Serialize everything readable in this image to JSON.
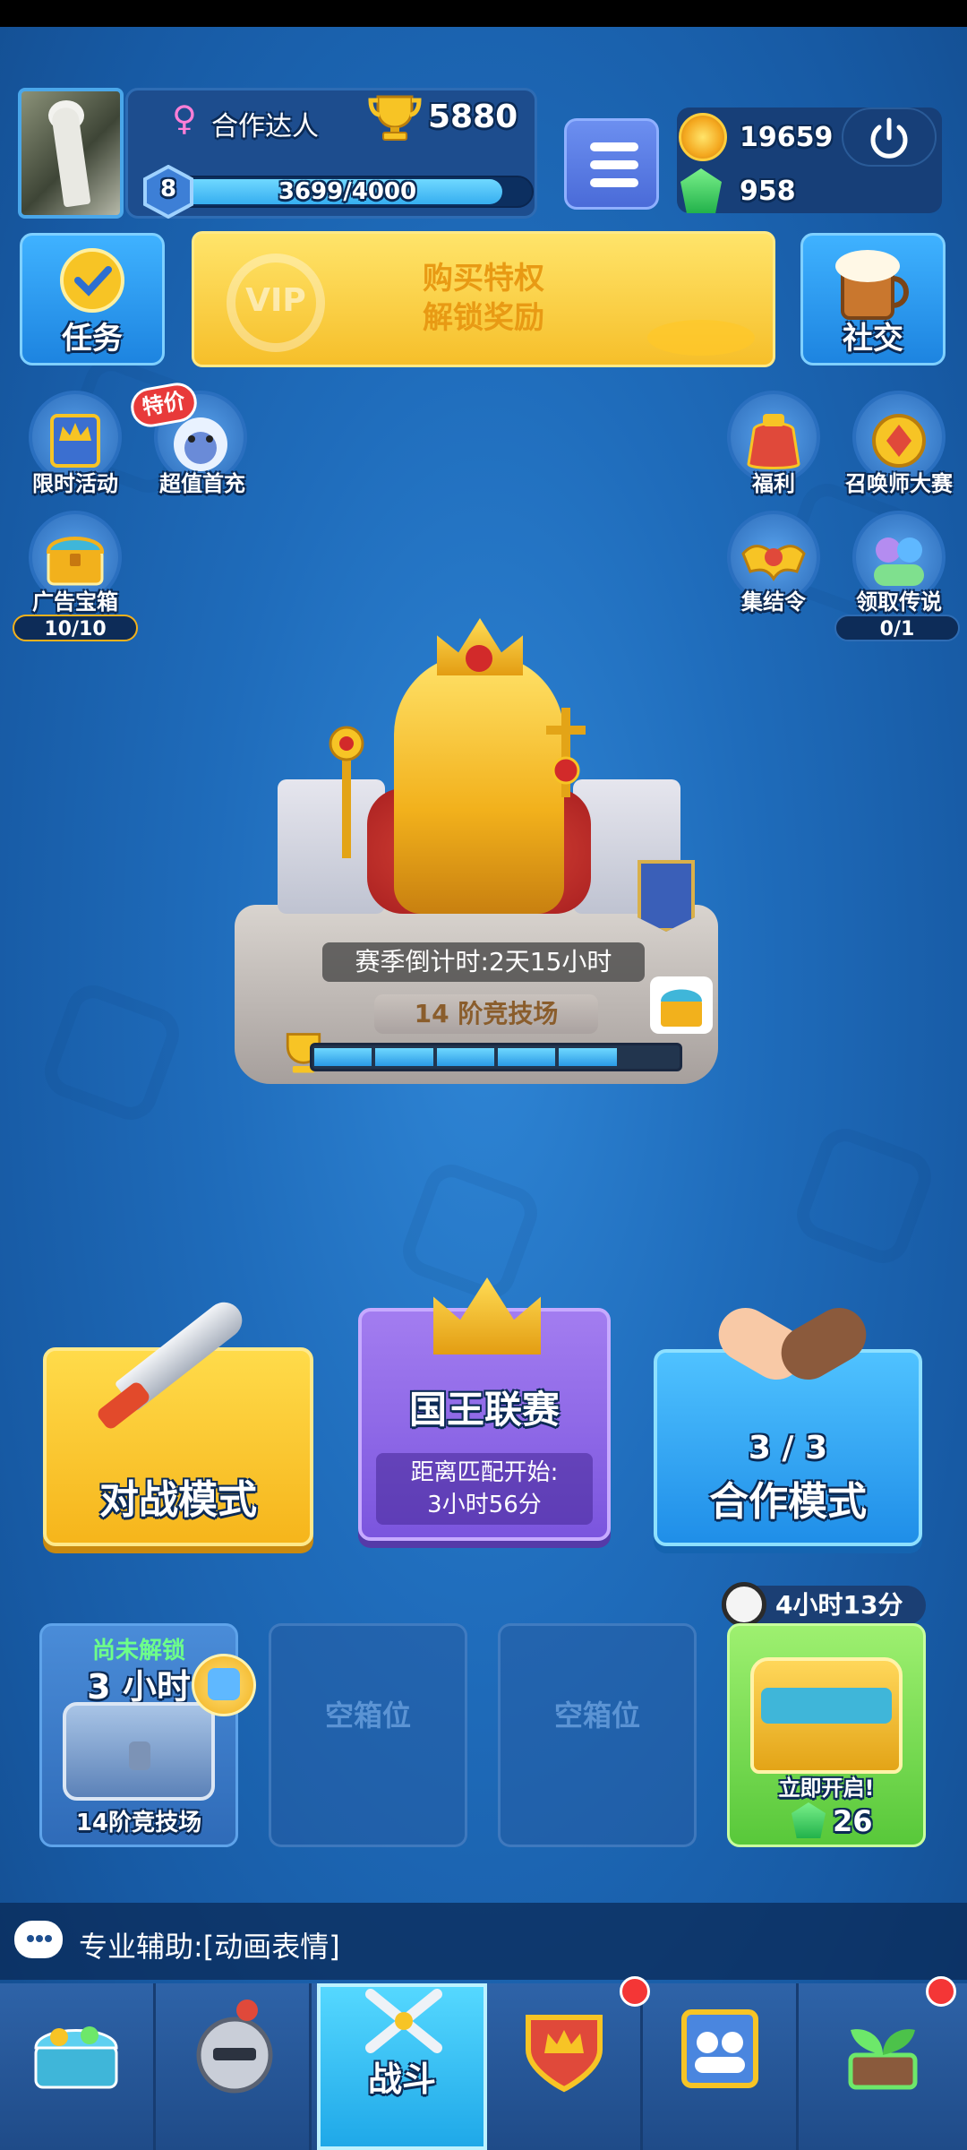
{
  "player": {
    "name": "合作达人",
    "trophies": "5880",
    "level": "8",
    "xp": "3699/4000",
    "xp_fraction": 0.925
  },
  "currency": {
    "gold": "19659",
    "gems": "958"
  },
  "top_buttons": {
    "tasks": "任务",
    "vip_line1": "购买特权",
    "vip_line2": "解锁奖励",
    "vip_badge": "VIP",
    "social": "社交"
  },
  "side_left": [
    {
      "label": "限时活动",
      "badge": ""
    },
    {
      "label": "超值首充",
      "badge": "特价"
    },
    {
      "label": "广告宝箱",
      "counter": "10/10"
    }
  ],
  "side_right": [
    {
      "label": "福利"
    },
    {
      "label": "召唤师大赛"
    },
    {
      "label": "集结令"
    },
    {
      "label": "领取传说",
      "counter": "0/1"
    }
  ],
  "arena": {
    "countdown": "赛季倒计时:2天15小时",
    "name": "14 阶竞技场",
    "progress_segments_filled": 5,
    "progress_segments_total": 6
  },
  "modes": {
    "battle": "对战模式",
    "king_title": "国王联赛",
    "king_info_line1": "距离匹配开始:",
    "king_info_line2": "3小时56分",
    "coop_count": "3 / 3",
    "coop": "合作模式"
  },
  "chests": {
    "slot1_status": "尚未解锁",
    "slot1_time": "3 小时",
    "slot1_name": "14阶竞技场",
    "empty_label": "空箱位",
    "slot4_timer": "4小时13分",
    "slot4_open": "立即开启!",
    "slot4_cost": "26"
  },
  "chat": {
    "message": "专业辅助:[动画表情]"
  },
  "nav": {
    "active_label": "战斗",
    "items": [
      "shop",
      "cards",
      "battle",
      "clan",
      "social",
      "events"
    ],
    "reddots": [
      "clan",
      "events"
    ]
  },
  "colors": {
    "background": "#1f6cbb",
    "gold": "#f6b51b",
    "purple": "#7b55de",
    "cyan": "#1f8ee8",
    "green": "#58c83a"
  }
}
